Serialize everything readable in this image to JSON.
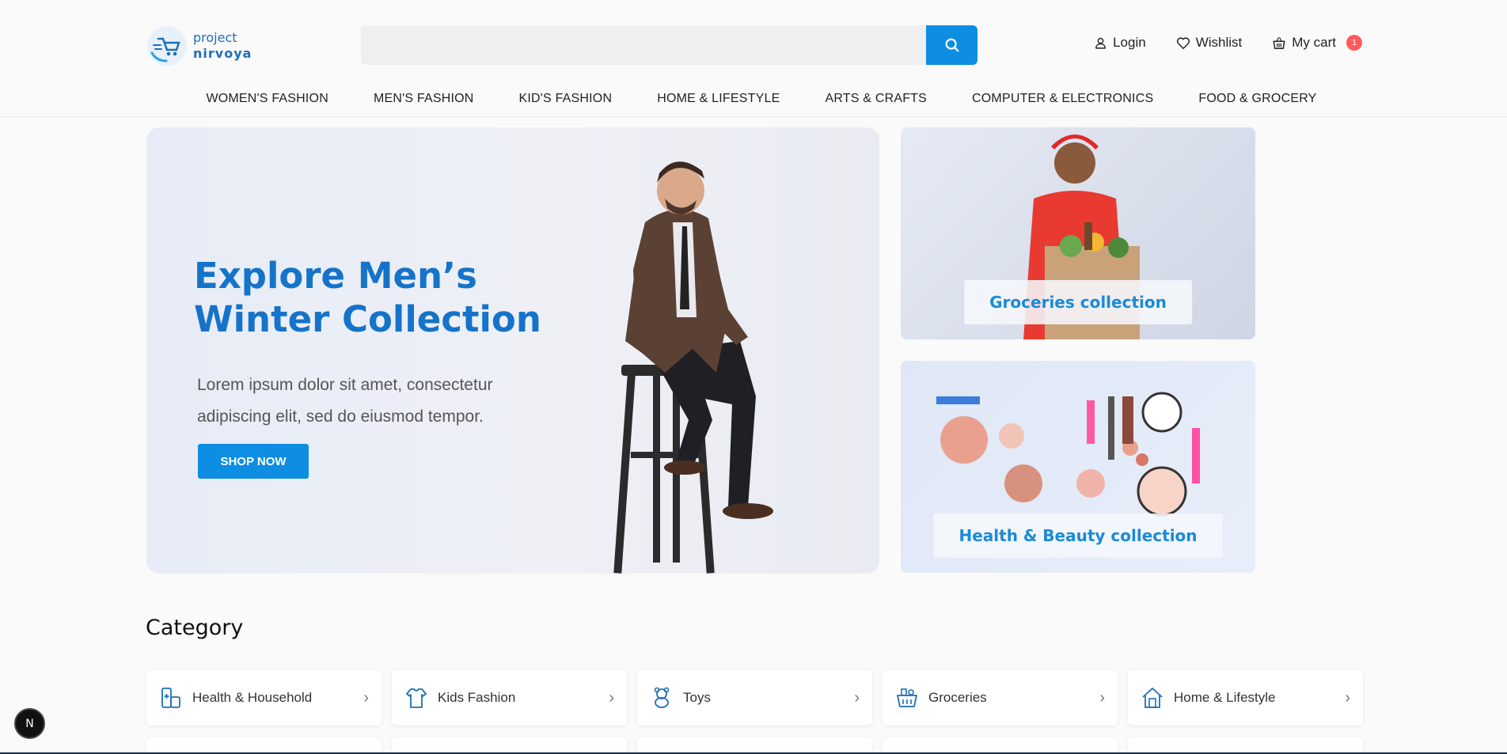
{
  "header": {
    "logo": {
      "line1": "project",
      "line2": "nirvoya"
    },
    "search": {
      "placeholder": "",
      "value": ""
    },
    "actions": {
      "login": "Login",
      "wishlist": "Wishlist",
      "cart": "My cart",
      "cart_count": "1"
    },
    "nav": [
      "WOMEN'S FASHION",
      "MEN'S FASHION",
      "KID'S FASHION",
      "HOME & LIFESTYLE",
      "ARTS & CRAFTS",
      "COMPUTER & ELECTRONICS",
      "FOOD & GROCERY"
    ]
  },
  "hero": {
    "title": "Explore Men’s Winter Collection",
    "text": "Lorem ipsum dolor sit amet, consectetur adipiscing elit, sed do eiusmod tempor.",
    "button": "SHOP NOW"
  },
  "promos": [
    {
      "label": "Groceries collection"
    },
    {
      "label": "Health & Beauty collection"
    }
  ],
  "category": {
    "title": "Category",
    "items": [
      {
        "label": "Health & Household",
        "icon": "health-household-icon"
      },
      {
        "label": "Kids Fashion",
        "icon": "kids-fashion-icon"
      },
      {
        "label": "Toys",
        "icon": "toys-icon"
      },
      {
        "label": "Groceries",
        "icon": "groceries-icon"
      },
      {
        "label": "Home & Lifestyle",
        "icon": "home-lifestyle-icon"
      }
    ]
  },
  "floating": {
    "label": "N"
  },
  "colors": {
    "accent": "#0d8ee3",
    "heading_blue": "#1573c9",
    "badge": "#ff5a5a"
  }
}
